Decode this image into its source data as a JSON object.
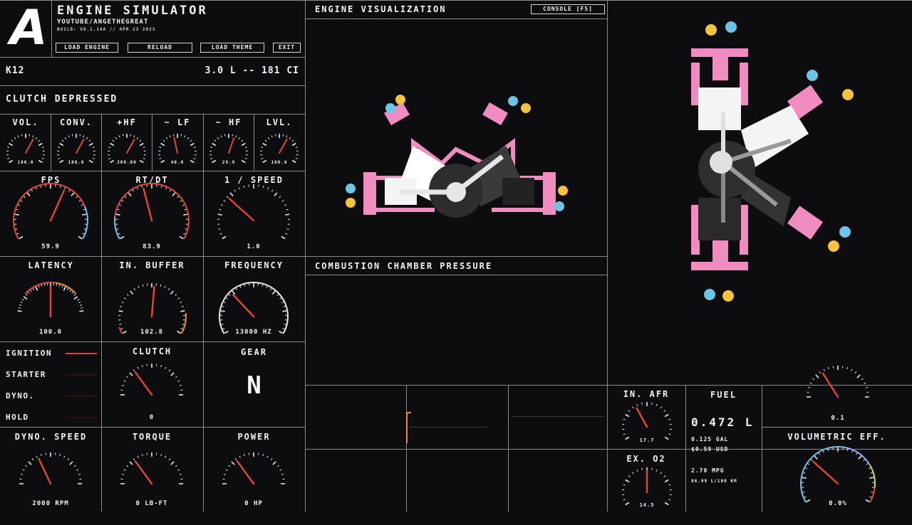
{
  "app": {
    "logo_letter": "A",
    "title": "ENGINE SIMULATOR",
    "author": "YOUTUBE/ANGETHEGREAT",
    "build": "BUILD: V0.1.14A // APR 23 2023",
    "buttons": {
      "load_engine": "LOAD ENGINE",
      "reload": "RELOAD",
      "load_theme": "LOAD THEME",
      "exit": "EXIT"
    }
  },
  "engine": {
    "name": "K12",
    "displacement": "3.0 L -- 181 CI"
  },
  "status": {
    "clutch_state": "CLUTCH DEPRESSED"
  },
  "audio_gauges": [
    {
      "label": "VOL.",
      "value": "100.0",
      "level": 0.62
    },
    {
      "label": "CONV.",
      "value": "100.0",
      "level": 0.62
    },
    {
      "label": "+HF",
      "value": "300.00",
      "level": 0.62
    },
    {
      "label": "~ LF",
      "value": "40.0",
      "level": 0.45
    },
    {
      "label": "~ HF",
      "value": "29.9",
      "level": 0.58
    },
    {
      "label": "LVL.",
      "value": "100.0",
      "level": 0.62
    }
  ],
  "perf_gauges": [
    {
      "label": "FPS",
      "value": "59.9",
      "level": 0.6
    },
    {
      "label": "RT/DT",
      "value": "83.9",
      "level": 0.44
    },
    {
      "label": "1 / SPEED",
      "value": "1.0",
      "level": 0.3
    }
  ],
  "timing_gauges": [
    {
      "label": "LATENCY",
      "value": "100.0",
      "level": 0.5
    },
    {
      "label": "IN. BUFFER",
      "value": "102.8",
      "level": 0.52
    },
    {
      "label": "FREQUENCY",
      "value": "13000 HZ",
      "level": 0.32
    }
  ],
  "indicators": [
    {
      "label": "IGNITION",
      "on": true
    },
    {
      "label": "STARTER",
      "on": false
    },
    {
      "label": "DYNO.",
      "on": false
    },
    {
      "label": "HOLD",
      "on": false
    }
  ],
  "clutch": {
    "label": "CLUTCH",
    "value": "0",
    "level": 0.3
  },
  "gear": {
    "label": "GEAR",
    "value": "N"
  },
  "output_gauges": [
    {
      "label": "DYNO. SPEED",
      "value": "2000 RPM",
      "level": 0.36
    },
    {
      "label": "TORQUE",
      "value": "0 LB-FT",
      "level": 0.3
    },
    {
      "label": "POWER",
      "value": "0 HP",
      "level": 0.3
    }
  ],
  "panels": {
    "engine_visualization": "ENGINE VISUALIZATION",
    "console_button": "CONSOLE [F5]",
    "combustion_pressure": "COMBUSTION CHAMBER PRESSURE"
  },
  "afr": {
    "label": "IN. AFR",
    "value": "17.7",
    "level": 0.38
  },
  "ex_o2": {
    "label": "EX. O2",
    "value": "14.5",
    "level": 0.5
  },
  "fuel": {
    "label": "FUEL",
    "liters": "0.472 L",
    "gallons": "0.125 GAL",
    "cost": "$0.59 USD",
    "mpg": "2.70 MPG",
    "l_per_100km": "86.99 L/100 KM"
  },
  "top_right_gauge": {
    "value": "0.1",
    "level": 0.32
  },
  "volumetric_eff": {
    "label": "VOLUMETRIC EFF.",
    "value": "0.0%",
    "level": 0.3
  },
  "colors": {
    "pink": "#f08cc0",
    "blue": "#6cc4e6",
    "yellow": "#f5c33b",
    "red": "#e0453a",
    "orange": "#ef8a3c",
    "grid": "#8a8a8a"
  }
}
